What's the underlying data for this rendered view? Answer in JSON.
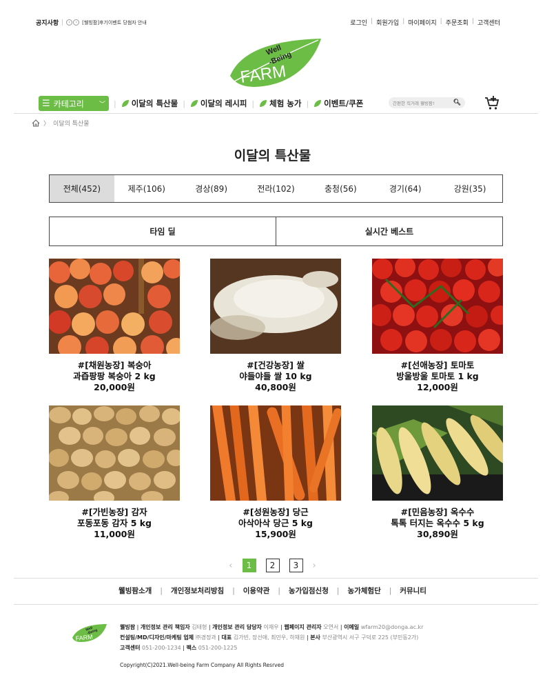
{
  "topbar": {
    "notice_label": "공지사항",
    "notice_text": "[웰빙팜]후기이벤트 당첨자 안내",
    "links": [
      "로그인",
      "회원가입",
      "마이페이지",
      "주문조회",
      "고객센터"
    ]
  },
  "logo": {
    "line1": "Well",
    "line2": "-Being",
    "line3": "FARM"
  },
  "nav": {
    "category_label": "카테고리",
    "items": [
      "이달의 특산물",
      "이달의 레시피",
      "체험 농가",
      "이벤트/쿠폰"
    ],
    "search_placeholder": "간편한 직거래 웰빙팜!"
  },
  "breadcrumb": {
    "current": "이달의 특산물"
  },
  "page_title": "이달의 특산물",
  "regions": [
    "전체(452)",
    "제주(106)",
    "경상(89)",
    "전라(102)",
    "충청(56)",
    "경기(64)",
    "강원(35)"
  ],
  "tabs": [
    "타임 딜",
    "실시간 베스트"
  ],
  "products": [
    {
      "title": "#[채원농장] 복숭아",
      "desc": "과즙팡팡 복숭아 2 kg",
      "price": "20,000원"
    },
    {
      "title": "#[건강농장] 쌀",
      "desc": "야들야들 쌀 10 kg",
      "price": "40,800원"
    },
    {
      "title": "#[선애농장] 토마토",
      "desc": "방울방울 토마토 1 kg",
      "price": "12,000원"
    },
    {
      "title": "#[가빈농장] 감자",
      "desc": "포동포동 감자 5 kg",
      "price": "11,000원"
    },
    {
      "title": "#[성원농장] 당근",
      "desc": "아삭아삭 당근 5 kg",
      "price": "15,900원"
    },
    {
      "title": "#[민음농장] 옥수수",
      "desc": "톡톡 터지는 옥수수 5 kg",
      "price": "30,890원"
    }
  ],
  "pagination": {
    "pages": [
      "1",
      "2",
      "3"
    ],
    "current": "1"
  },
  "footer": {
    "links": [
      "웰빙팜소개",
      "개인정보처리방침",
      "이용약관",
      "농가입점신청",
      "농가체험단",
      "커뮤니티"
    ],
    "l1_a": "웰빙팜",
    "l1_b": "개인정보 관리 책임자",
    "l1_c": "김태형",
    "l1_d": "개인정보 관리 담당자",
    "l1_e": "이재우",
    "l1_f": "웹페이지 관리자",
    "l1_g": "오연서",
    "l1_h": "이메일",
    "l1_i": "wfarm20@donga.ac.kr",
    "l2_a": "컨설팅/MD/디자인/마케팅 업체",
    "l2_b": "㈜경정과",
    "l2_c": "대표",
    "l2_d": "김가빈, 장선애, 최민우, 하채원",
    "l2_e": "본사",
    "l2_f": "부산광역시 서구 구덕로 225 (부민동2가)",
    "l3_a": "고객센터",
    "l3_b": "051-200-1234",
    "l3_c": "팩스",
    "l3_d": "051-200-1225",
    "copyright": "Copyright(C)2021.Well-being Farm Company All Rights Resrved"
  },
  "colors": {
    "brand_green": "#6cbd45"
  }
}
